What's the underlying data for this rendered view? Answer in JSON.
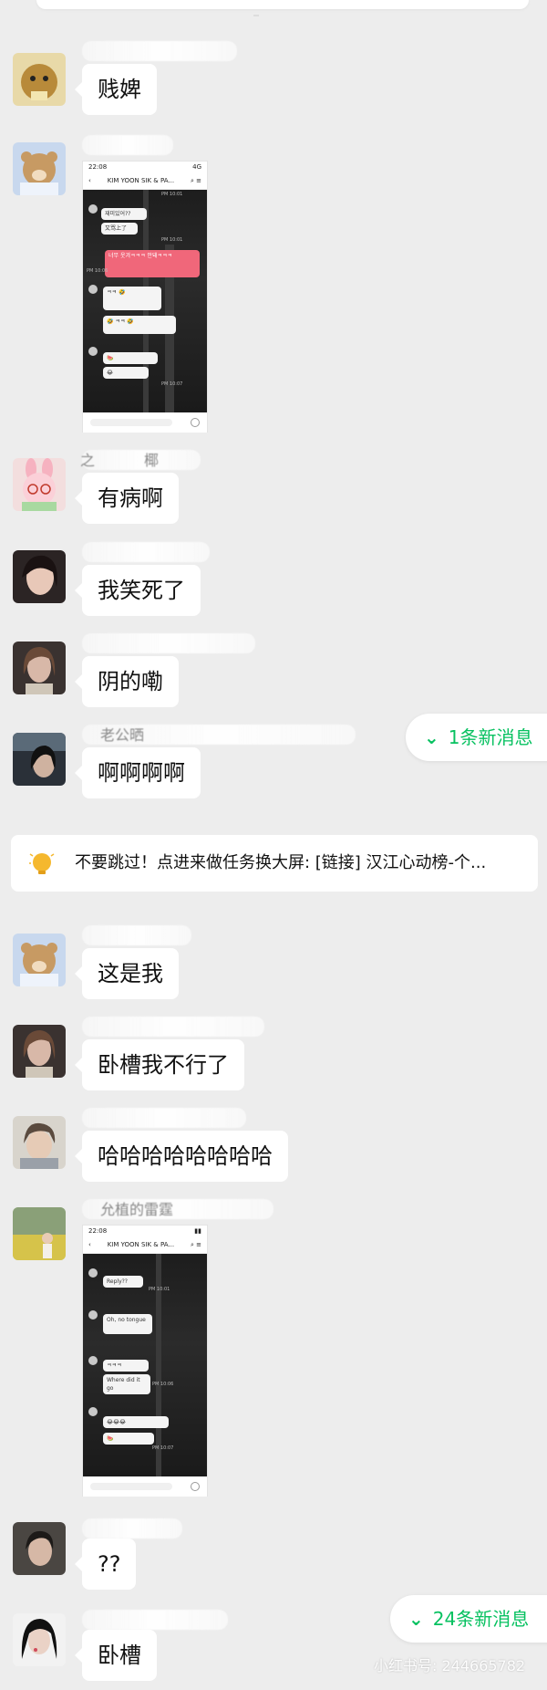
{
  "messages": [
    {
      "text": "贱婢"
    },
    {
      "text": "有病啊"
    },
    {
      "text": "我笑死了"
    },
    {
      "text": "阴的嘞"
    },
    {
      "text": "啊啊啊啊"
    },
    {
      "text": "这是我"
    },
    {
      "text": "卧槽我不行了"
    },
    {
      "text": "哈哈哈哈哈哈哈哈"
    },
    {
      "text": "??"
    },
    {
      "text": "卧槽"
    }
  ],
  "nick_fragments": {
    "row4": "之",
    "row4_end": "椰",
    "row7": "老公晒",
    "row13": "允植的雷霆"
  },
  "screenshot1": {
    "time": "22:08",
    "signal": "4G",
    "chat_title": "KIM YOON SIK & PA...",
    "msgs": [
      "재미있어??",
      "又骂上了",
      "너무 웃겨ㅋㅋㅋ 안돼ㅋㅋㅋ",
      "PM 10:01",
      "PM 10:01",
      "PM 10:06",
      "PM 10:07"
    ]
  },
  "screenshot2": {
    "time": "22:08",
    "chat_title": "KIM YOON SIK & PA...",
    "msgs": [
      "Reply??",
      "Oh, no tongue",
      "Where did it go",
      "PM 10:01",
      "PM 10:06",
      "PM 10:07"
    ]
  },
  "new_messages": {
    "first": "1条新消息",
    "second": "24条新消息"
  },
  "notice": {
    "text": "不要跳过！点进来做任务换大屏: [链接] 汉江心动榜-个..."
  },
  "watermark": "小红书号: 244665782",
  "colors": {
    "background": "#ededed",
    "bubble": "#ffffff",
    "accent_green": "#07c160",
    "pink_bubble": "#f0677a"
  },
  "icons": [
    "chevron-down-icon",
    "lightbulb-icon"
  ]
}
